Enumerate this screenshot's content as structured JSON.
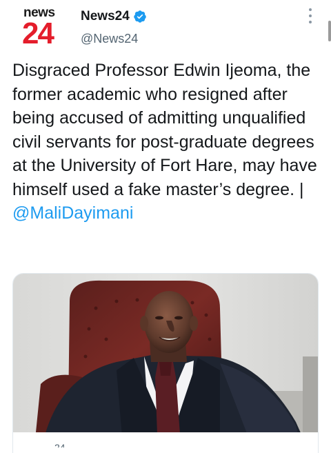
{
  "account": {
    "logo_top": "news",
    "logo_number": "24",
    "display_name": "News24",
    "handle": "@News24",
    "verified_icon": "verified-badge-icon"
  },
  "tweet": {
    "text_before_mention": "Disgraced Professor Edwin Ijeoma, the former academic who resigned after being accused of admitting unqualified civil servants for post-graduate degrees at the University of Fort Hare, may have himself used a fake master’s degree. | ",
    "mention": "@MaliDayimani"
  },
  "card": {
    "domain_fragment": "24"
  },
  "colors": {
    "logo_red": "#e41d2b",
    "link_blue": "#1d9bf0",
    "verified_blue": "#1d9bf0",
    "secondary_text": "#536471"
  }
}
